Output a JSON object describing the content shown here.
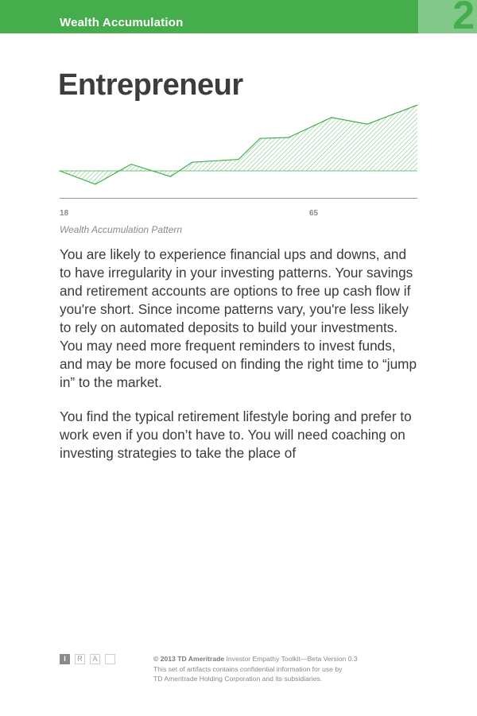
{
  "header": {
    "section_title": "Wealth Accumulation",
    "chapter_number": "2",
    "brand_color": "#45ad4c"
  },
  "page_title": "Entrepreneur",
  "chart_data": {
    "type": "area",
    "title": "",
    "caption": "Wealth Accumulation Pattern",
    "x_tick_labels": [
      "18",
      "65"
    ],
    "line_color": "#45ad4c",
    "fill": "diagonal hatch",
    "points": [
      {
        "x": 0,
        "y": 0
      },
      {
        "x": 0.5,
        "y": -0.7
      },
      {
        "x": 1,
        "y": 0.35
      },
      {
        "x": 1.55,
        "y": -0.3
      },
      {
        "x": 1.85,
        "y": 0.45
      },
      {
        "x": 2.5,
        "y": 0.6
      },
      {
        "x": 2.8,
        "y": 1.7
      },
      {
        "x": 3.2,
        "y": 1.75
      },
      {
        "x": 3.8,
        "y": 2.8
      },
      {
        "x": 4.3,
        "y": 2.45
      },
      {
        "x": 5,
        "y": 3.45
      }
    ],
    "baseline": 0
  },
  "body": {
    "paragraph_1": "You are likely to experience financial ups and downs, and to have irregularity in your investing patterns. Your savings and retirement accounts are options to free up cash flow if you're short. Since income patterns vary, you're less likely to rely on automated deposits to build your investments. You may need more frequent reminders to invest funds, and may be more focused on finding the right time to “jump in” to the market.",
    "paragraph_2": "You find the typical retirement lifestyle boring and prefer to work even if you don’t have to. You will need coaching on investing strategies to take the place of"
  },
  "footer": {
    "boxes": [
      "I",
      "R",
      "A",
      ""
    ],
    "copyright_bold": "© 2013 TD Ameritrade",
    "copyright_rest": " Investor Empathy Toolkit—Beta Version 0.3",
    "line_2": "This set of artifacts contains confidential information for use by",
    "line_3": "TD Ameritrade Holding Corporation and its subsidiaries."
  }
}
